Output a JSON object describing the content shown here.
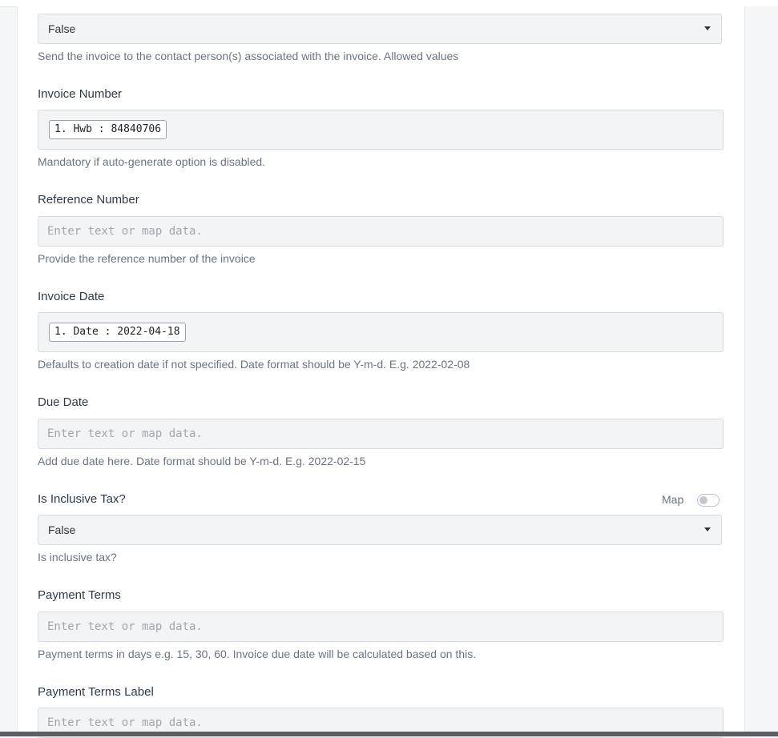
{
  "send_to_contacts": {
    "selected": "False",
    "help": "Send the invoice to the contact person(s) associated with the invoice. Allowed values"
  },
  "invoice_number": {
    "label": "Invoice Number",
    "chip": "1. Hwb : 84840706",
    "help": "Mandatory if auto-generate option is disabled."
  },
  "reference_number": {
    "label": "Reference Number",
    "placeholder": "Enter text or map data.",
    "help": "Provide the reference number of the invoice"
  },
  "invoice_date": {
    "label": "Invoice Date",
    "chip": "1. Date : 2022-04-18",
    "help": "Defaults to creation date if not specified. Date format should be Y-m-d. E.g. 2022-02-08"
  },
  "due_date": {
    "label": "Due Date",
    "placeholder": "Enter text or map data.",
    "help": "Add due date here. Date format should be Y-m-d. E.g. 2022-02-15"
  },
  "inclusive_tax": {
    "label": "Is Inclusive Tax?",
    "map_label": "Map",
    "map_enabled": false,
    "selected": "False",
    "help": "Is inclusive tax?"
  },
  "payment_terms": {
    "label": "Payment Terms",
    "placeholder": "Enter text or map data.",
    "help": "Payment terms in days e.g. 15, 30, 60. Invoice due date will be calculated based on this."
  },
  "payment_terms_label": {
    "label": "Payment Terms Label",
    "placeholder": "Enter text or map data."
  }
}
